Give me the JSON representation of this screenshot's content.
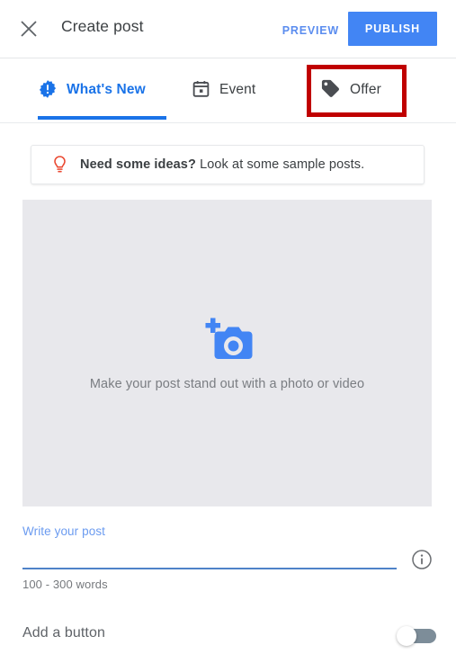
{
  "header": {
    "close_icon": "close-icon",
    "title": "Create post",
    "preview_label": "PREVIEW",
    "publish_label": "PUBLISH",
    "publish_color": "#4285f4",
    "preview_color": "#5b8def"
  },
  "tabs": {
    "items": [
      {
        "id": "whats-new",
        "label": "What's New",
        "icon": "announcement-badge-icon",
        "active": true
      },
      {
        "id": "event",
        "label": "Event",
        "icon": "calendar-icon",
        "active": false
      },
      {
        "id": "offer",
        "label": "Offer",
        "icon": "tag-icon",
        "active": false
      }
    ],
    "active_color": "#1a73e8",
    "highlight_color": "#c00000"
  },
  "ideas_banner": {
    "icon": "lightbulb-icon",
    "icon_color": "#ea4a33",
    "strong_text": "Need some ideas?",
    "rest_text": " Look at some sample posts."
  },
  "media": {
    "icon": "add-photo-camera-icon",
    "icon_color": "#4285f4",
    "caption": "Make your post stand out with a photo or video",
    "background": "#e8e8ec"
  },
  "post_field": {
    "label": "Write your post",
    "value": "",
    "placeholder": "",
    "hint": "100 - 300 words",
    "info_icon": "info-circle-icon",
    "underline_color": "#4f82c8"
  },
  "add_button_row": {
    "label": "Add a button",
    "toggle_state": "off",
    "toggle_track_color": "#7d8d99"
  }
}
